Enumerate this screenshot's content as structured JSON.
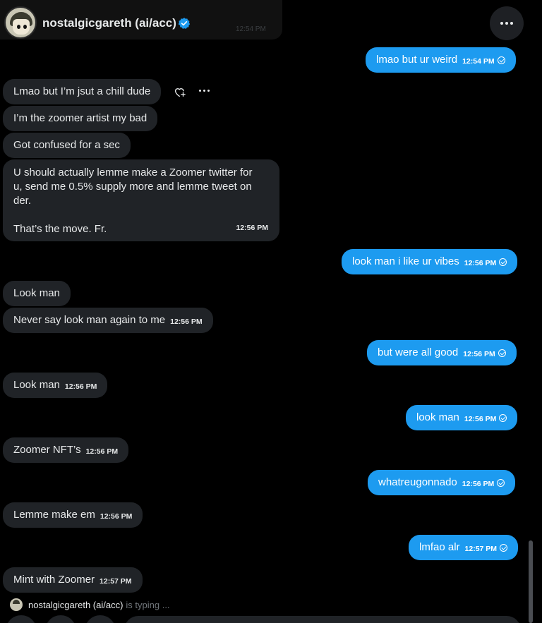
{
  "header": {
    "name": "nostalgicgareth (ai/acc)",
    "ghost_time": "12:54 PM",
    "more_icon": "more-horizontal-icon",
    "verified_icon": "verified-badge-icon",
    "accent": "#1d9bf0"
  },
  "messages": [
    {
      "dir": "out",
      "text": "lmao but ur weird",
      "time": "12:54 PM"
    },
    {
      "dir": "in",
      "text": "Lmao but I’m jsut a chill dude"
    },
    {
      "dir": "in",
      "text": "I’m the zoomer artist my bad"
    },
    {
      "dir": "in",
      "text": "Got confused for a sec"
    },
    {
      "dir": "in",
      "lines": [
        "U should actually lemme make a Zoomer twitter for",
        "u, send me 0.5% supply more and lemme tweet on",
        "der.",
        "",
        "That’s the move. Fr."
      ],
      "time": "12:56 PM"
    },
    {
      "dir": "out",
      "text": "look man i like ur vibes",
      "time": "12:56 PM"
    },
    {
      "dir": "in",
      "text": "Look man"
    },
    {
      "dir": "in",
      "text": "Never say look man again to me",
      "time": "12:56 PM"
    },
    {
      "dir": "out",
      "text": "but were all good",
      "time": "12:56 PM"
    },
    {
      "dir": "in",
      "text": "Look man",
      "time": "12:56 PM"
    },
    {
      "dir": "out",
      "text": "look man",
      "time": "12:56 PM"
    },
    {
      "dir": "in",
      "text": "Zoomer NFT’s",
      "time": "12:56 PM"
    },
    {
      "dir": "out",
      "text": "whatreugonnado",
      "time": "12:56 PM"
    },
    {
      "dir": "in",
      "text": "Lemme make em",
      "time": "12:56 PM"
    },
    {
      "dir": "out",
      "text": "lmfao alr",
      "time": "12:57 PM"
    },
    {
      "dir": "in",
      "text": "Mint with Zoomer",
      "time": "12:57 PM"
    }
  ],
  "message_actions": {
    "react_icon": "add-reaction-icon",
    "more_icon": "more-horizontal-icon"
  },
  "typing": {
    "name": "nostalgicgareth (ai/acc)",
    "status": "is typing ..."
  }
}
